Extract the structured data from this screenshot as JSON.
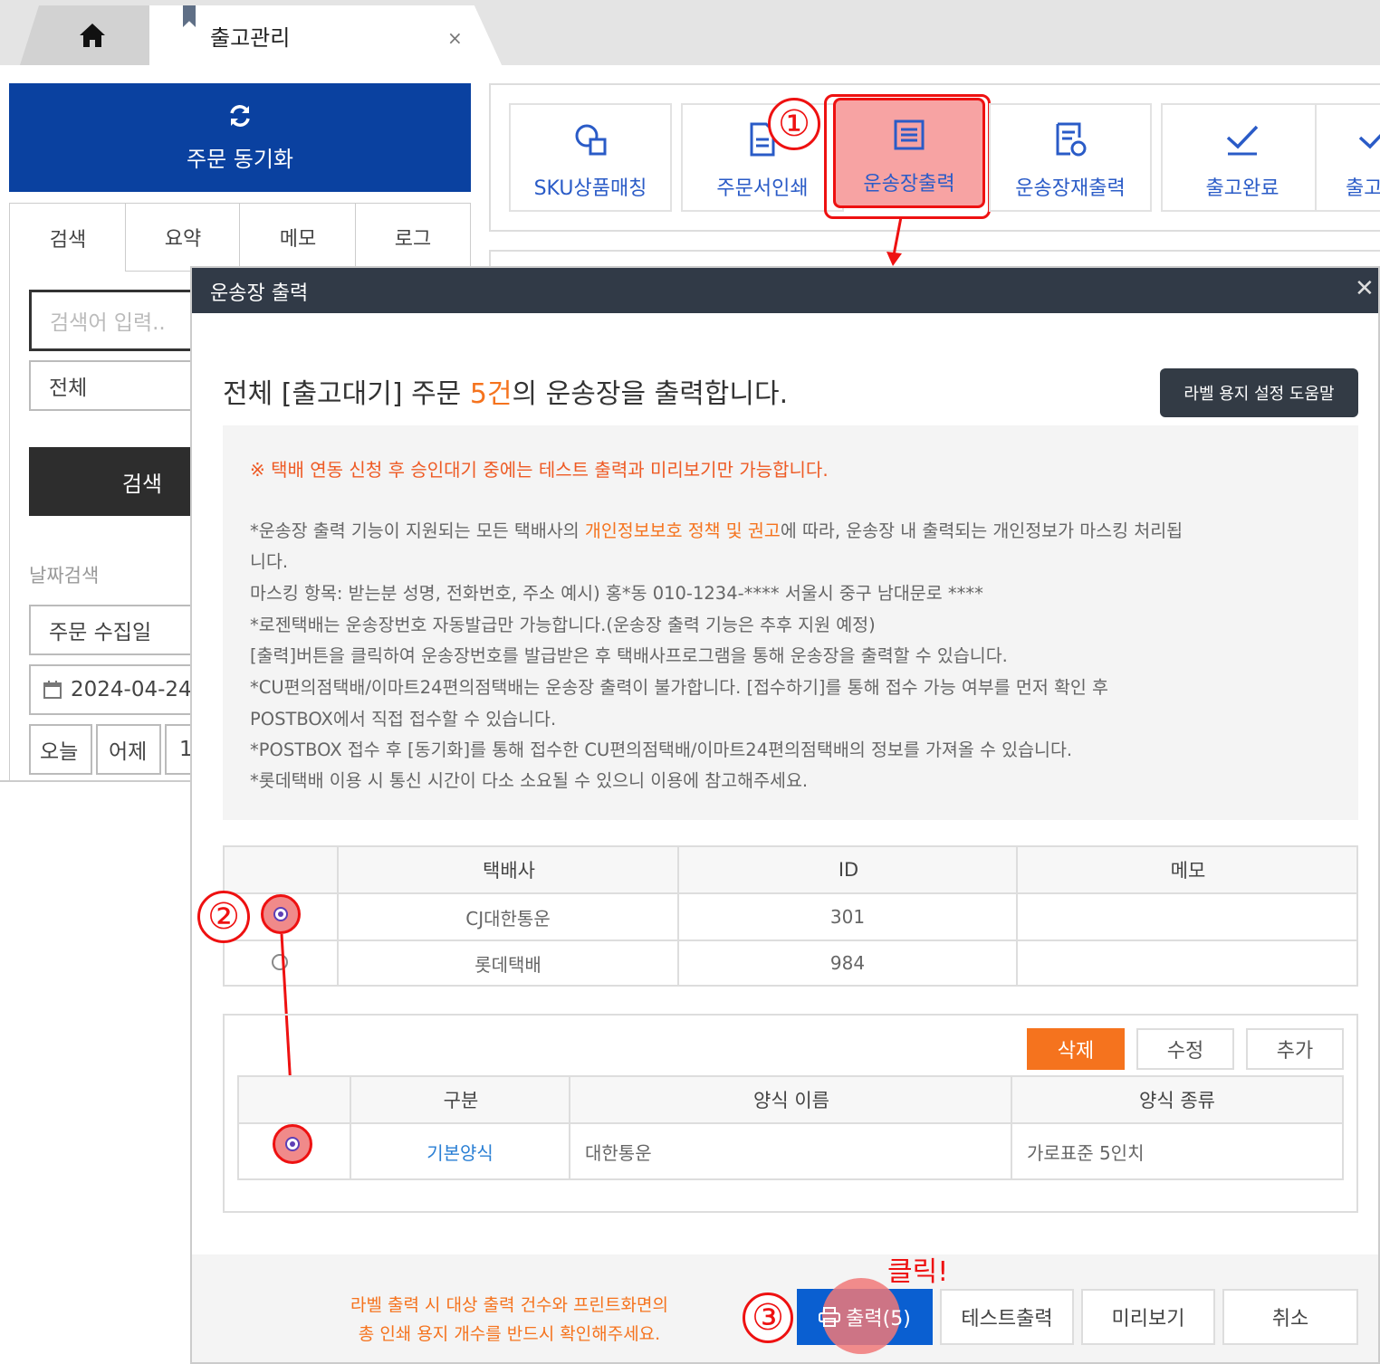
{
  "tabs": {
    "home_icon": "home-icon",
    "active_title": "출고관리",
    "close_glyph": "×"
  },
  "left": {
    "sync_label": "주문 동기화",
    "tabs": [
      "검색",
      "요약",
      "메모",
      "로그"
    ],
    "search_placeholder": "검색어 입력..",
    "filter_value": "전체",
    "search_button": "검색",
    "date_label": "날짜검색",
    "date_type": "주문 수집일",
    "date_value": "2024-04-24",
    "quick_dates": [
      "오늘",
      "어제",
      "1"
    ]
  },
  "toolbar": {
    "items": [
      {
        "label": "SKU상품매칭",
        "icon": "product-match-icon"
      },
      {
        "label": "주문서인쇄",
        "icon": "document-icon"
      },
      {
        "label": "운송장출력",
        "icon": "waybill-print-icon"
      },
      {
        "label": "운송장재출력",
        "icon": "waybill-reprint-icon"
      },
      {
        "label": "출고완료",
        "icon": "check-icon"
      },
      {
        "label": "출고",
        "icon": "more-icon"
      }
    ]
  },
  "modal": {
    "title": "운송장 출력",
    "close_glyph": "✕",
    "summary_pre": "전체 [출고대기] 주문 ",
    "summary_count": "5건",
    "summary_post": "의 운송장을 출력합니다.",
    "help_button": "라벨 용지 설정 도움말",
    "warning": "※ 택배 연동 신청 후 승인대기 중에는 테스트 출력과 미리보기만 가능합니다.",
    "notice": {
      "l1_pre": "*운송장 출력 기능이 지원되는 모든 택배사의 ",
      "l1_link": "개인정보보호 정책 및 권고",
      "l1_post": "에 따라, 운송장 내 출력되는 개인정보가 마스킹 처리됩",
      "l2": "니다.",
      "l3": "마스킹 항목: 받는분 성명, 전화번호, 주소 예시) 홍*동 010-1234-**** 서울시 중구 남대문로 ****",
      "l4": "*로젠택배는 운송장번호 자동발급만 가능합니다.(운송장 출력 기능은 추후 지원 예정)",
      "l5": "[출력]버튼을 클릭하여 운송장번호를 발급받은 후 택배사프로그램을 통해 운송장을 출력할 수 있습니다.",
      "l6": "*CU편의점택배/이마트24편의점택배는 운송장 출력이 불가합니다. [접수하기]를 통해 접수 가능 여부를 먼저 확인 후",
      "l7": " POSTBOX에서 직접 접수할 수 있습니다.",
      "l8": "*POSTBOX 접수 후 [동기화]를 통해 접수한 CU편의점택배/이마트24편의점택배의 정보를 가져올 수 있습니다.",
      "l9": "*롯데택배 이용 시 통신 시간이 다소 소요될 수 있으니 이용에 참고해주세요."
    },
    "courier_table": {
      "headers": [
        "택배사",
        "ID",
        "메모"
      ],
      "rows": [
        {
          "courier": "CJ대한통운",
          "id": "301",
          "memo": "",
          "selected": true
        },
        {
          "courier": "롯데택배",
          "id": "984",
          "memo": "",
          "selected": false
        }
      ]
    },
    "form_buttons": {
      "delete": "삭제",
      "edit": "수정",
      "add": "추가"
    },
    "form_table": {
      "headers": [
        "구분",
        "양식 이름",
        "양식 종류"
      ],
      "rows": [
        {
          "category": "기본양식",
          "name": "대한통운",
          "type": "가로표준 5인치",
          "selected": true
        }
      ]
    },
    "footer": {
      "note_line1": "라벨 출력 시 대상 출력 건수와 프린트화면의",
      "note_line2": "총 인쇄 용지 개수를 반드시 확인해주세요.",
      "print_button": "출력(5)",
      "test_button": "테스트출력",
      "preview_button": "미리보기",
      "cancel_button": "취소"
    }
  },
  "annotations": {
    "step1": "①",
    "step2": "②",
    "step3": "③",
    "click_label": "클릭!"
  },
  "colors": {
    "primary_blue": "#0a41a0",
    "accent_orange": "#f5731e",
    "annotation_red": "#e11111",
    "modal_header": "#313a47"
  }
}
